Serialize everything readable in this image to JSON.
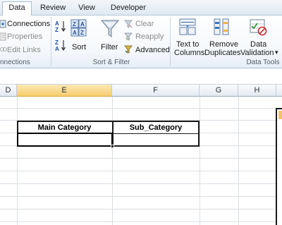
{
  "tabs": [
    {
      "label": "Data",
      "active": true
    },
    {
      "label": "Review",
      "active": false
    },
    {
      "label": "View",
      "active": false
    },
    {
      "label": "Developer",
      "active": false
    }
  ],
  "ribbon": {
    "connections": {
      "connections_label": "Connections",
      "properties_label": "Properties",
      "edit_links_label": "Edit Links",
      "group_label": "nnections"
    },
    "sort_filter": {
      "sort_label": "Sort",
      "filter_label": "Filter",
      "clear_label": "Clear",
      "reapply_label": "Reapply",
      "advanced_label": "Advanced",
      "group_label": "Sort & Filter"
    },
    "data_tools": {
      "text_to_columns_line1": "Text to",
      "text_to_columns_line2": "Columns",
      "remove_duplicates_line1": "Remove",
      "remove_duplicates_line2": "Duplicates",
      "data_validation_line1": "Data",
      "data_validation_line2": "Validation",
      "dropdown_arrow": "▾",
      "group_label": "Data Tools"
    }
  },
  "columns": [
    "D",
    "E",
    "F",
    "G",
    "H"
  ],
  "selected_column": "E",
  "cells": {
    "main_category": "Main Category",
    "sub_category": "Sub_Category"
  },
  "colors": {
    "selected_header": "#f6cd6e",
    "ribbon_border": "#a9bdd4",
    "grid_line": "#dadfe6"
  }
}
